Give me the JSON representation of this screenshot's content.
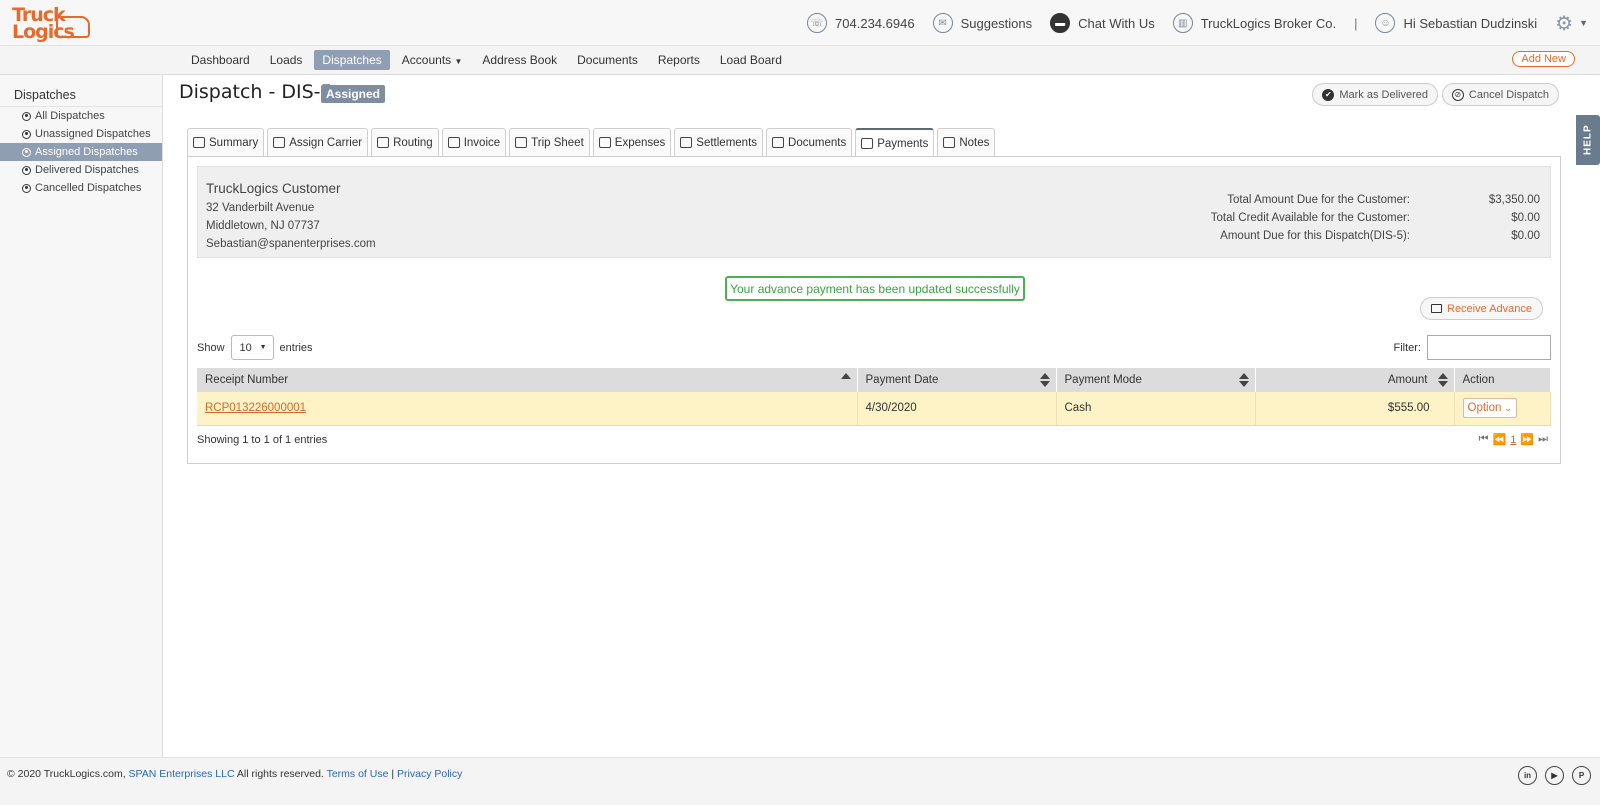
{
  "header": {
    "logo_line1": "Truck",
    "logo_line2": "Logics",
    "phone": "704.234.6946",
    "suggestions": "Suggestions",
    "chat": "Chat With Us",
    "company": "TruckLogics Broker Co.",
    "separator": "|",
    "user": "Hi Sebastian Dudzinski"
  },
  "menu": {
    "items": [
      "Dashboard",
      "Loads",
      "Dispatches",
      "Accounts",
      "Address Book",
      "Documents",
      "Reports",
      "Load Board"
    ],
    "active": "Dispatches",
    "add_new": "Add New"
  },
  "sidebar": {
    "title": "Dispatches",
    "items": [
      "All Dispatches",
      "Unassigned Dispatches",
      "Assigned Dispatches",
      "Delivered Dispatches",
      "Cancelled Dispatches"
    ],
    "active": "Assigned Dispatches"
  },
  "page": {
    "title": "Dispatch - DIS-5",
    "status": "Assigned",
    "mark_delivered": "Mark as Delivered",
    "cancel_dispatch": "Cancel Dispatch",
    "help": "HELP"
  },
  "tabs": [
    "Summary",
    "Assign Carrier",
    "Routing",
    "Invoice",
    "Trip Sheet",
    "Expenses",
    "Settlements",
    "Documents",
    "Payments",
    "Notes"
  ],
  "active_tab": "Payments",
  "customer": {
    "name": "TruckLogics Customer",
    "address1": "32 Vanderbilt Avenue",
    "address2": "Middletown, NJ 07737",
    "email": "Sebastian@spanenterprises.com"
  },
  "summary": {
    "total_due_label": "Total Amount Due for the Customer:",
    "total_due": "$3,350.00",
    "credit_label": "Total Credit Available for the Customer:",
    "credit": "$0.00",
    "dispatch_due_label": "Amount Due for this Dispatch(DIS-5):",
    "dispatch_due": "$0.00"
  },
  "success_message": "Your advance payment has been updated successfully",
  "receive_advance": "Receive Advance",
  "table_controls": {
    "show_label": "Show",
    "entries_value": "10",
    "entries_label": "entries",
    "filter_label": "Filter:"
  },
  "table": {
    "headers": [
      "Receipt Number",
      "Payment Date",
      "Payment Mode",
      "Amount",
      "Action"
    ],
    "rows": [
      {
        "receipt": "RCP013226000001",
        "date": "4/30/2020",
        "mode": "Cash",
        "amount": "$555.00",
        "action": "Option"
      }
    ]
  },
  "table_info": "Showing 1 to 1 of 1 entries",
  "pager": {
    "current": "1"
  },
  "footer": {
    "copyright": "© 2020 TruckLogics.com,",
    "company_link": "SPAN Enterprises LLC",
    "rights": "All rights reserved.",
    "terms": "Terms of Use",
    "divider": "|",
    "privacy": "Privacy Policy"
  },
  "colors": {
    "brand": "#e8692a",
    "active_nav": "#8f9eb3",
    "success": "#3aa341",
    "row_highlight": "#fdf3c6"
  }
}
